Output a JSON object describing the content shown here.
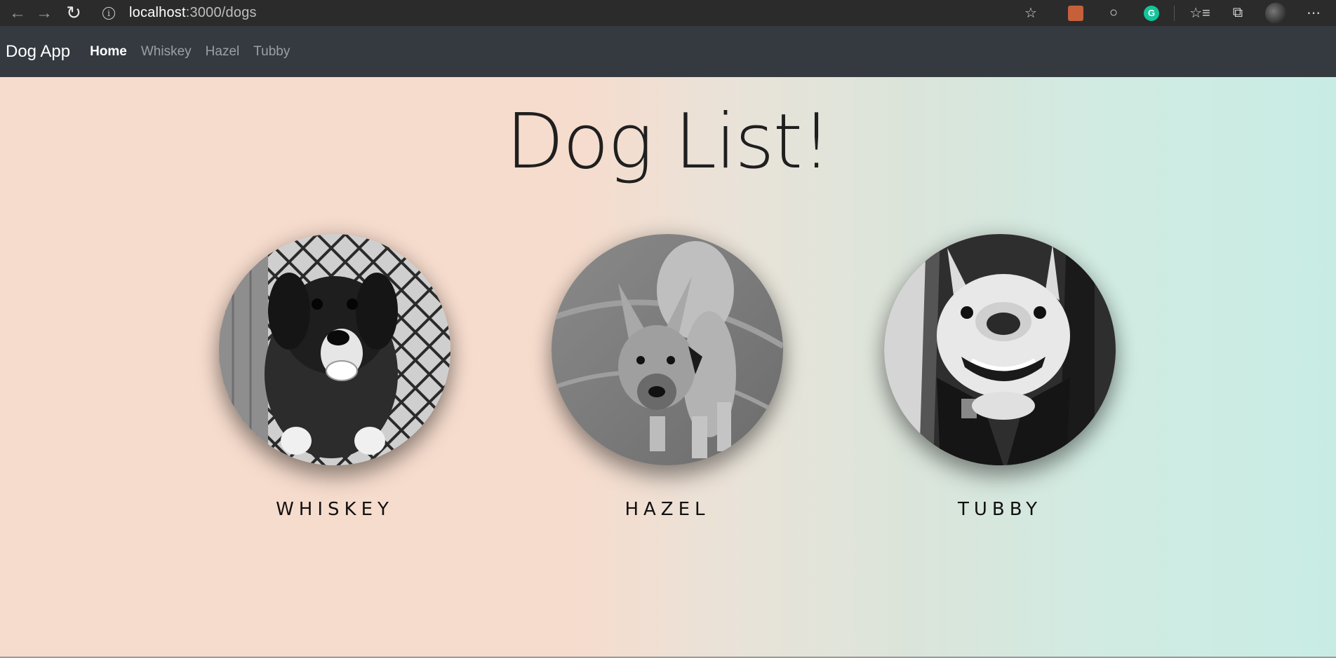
{
  "browser": {
    "url_host": "localhost",
    "url_path": ":3000/dogs"
  },
  "navbar": {
    "brand": "Dog App",
    "links": [
      {
        "label": "Home",
        "active": true
      },
      {
        "label": "Whiskey",
        "active": false
      },
      {
        "label": "Hazel",
        "active": false
      },
      {
        "label": "Tubby",
        "active": false
      }
    ]
  },
  "main": {
    "title": "Dog List!",
    "dogs": [
      {
        "name": "WHISKEY",
        "photo_icon": "dog-photo-whiskey"
      },
      {
        "name": "HAZEL",
        "photo_icon": "dog-photo-hazel"
      },
      {
        "name": "TUBBY",
        "photo_icon": "dog-photo-tubby"
      }
    ]
  }
}
